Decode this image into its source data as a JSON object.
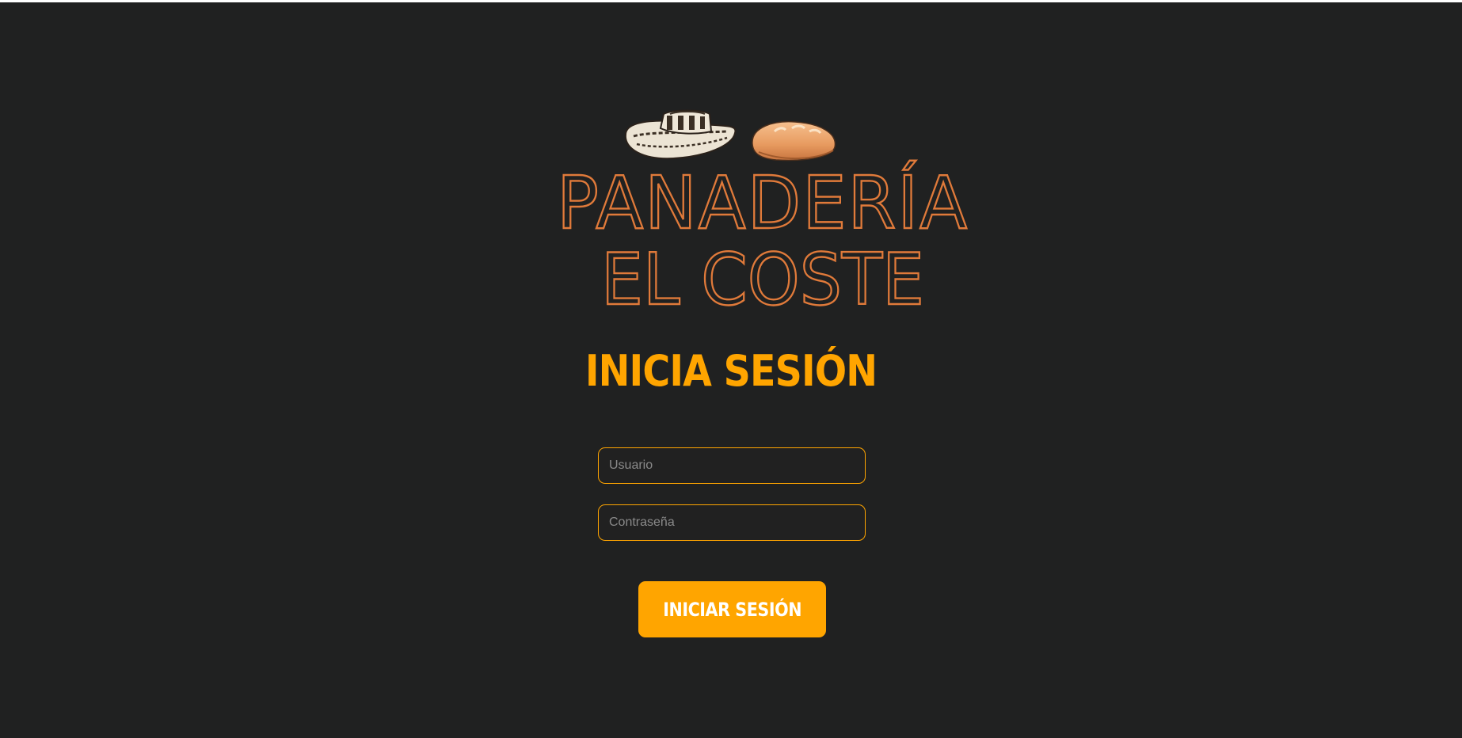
{
  "brand": {
    "line1": "PANADERÍA",
    "line2": "EL COSTE",
    "outline_color": "#e07a3a",
    "icons": [
      "sombrero-vueltiao-icon",
      "bread-icon"
    ]
  },
  "login": {
    "heading": "INICIA SESIÓN",
    "username_placeholder": "Usuario",
    "password_placeholder": "Contraseña",
    "submit_label": "INICIAR SESIÓN"
  },
  "colors": {
    "background": "#202121",
    "accent": "#ffa500",
    "button_text": "#ffffff"
  }
}
